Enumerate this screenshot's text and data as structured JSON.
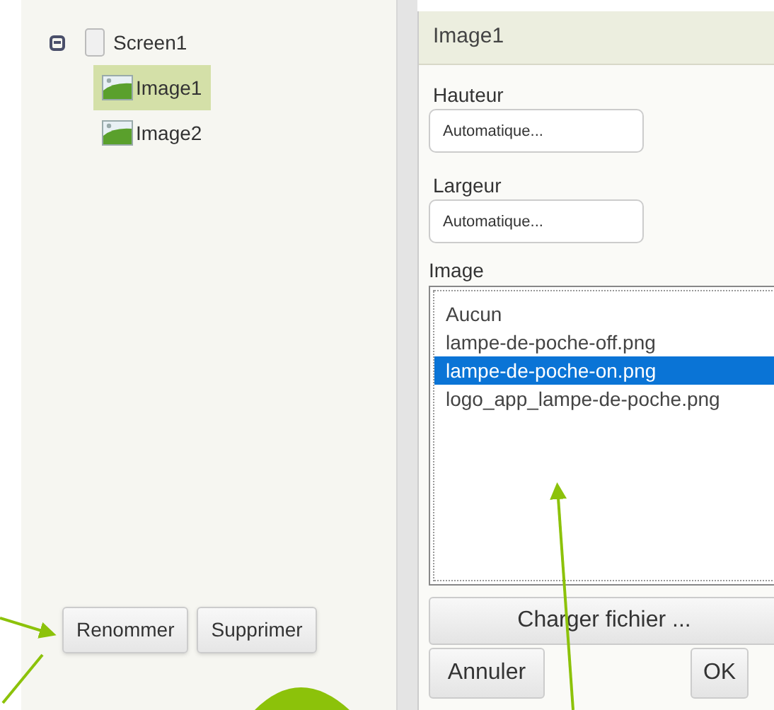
{
  "tree": {
    "label": "Screen1",
    "expanded": true,
    "children": [
      {
        "label": "Image1",
        "selected": true
      },
      {
        "label": "Image2",
        "selected": false
      }
    ]
  },
  "tree_buttons": [
    "Renommer",
    "Supprimer"
  ],
  "properties": {
    "title": "Image1",
    "fields": [
      {
        "label": "Hauteur",
        "value": "Automatique..."
      },
      {
        "label": "Largeur",
        "value": "Automatique..."
      }
    ],
    "image": {
      "label": "Image",
      "options": [
        {
          "label": "Aucun",
          "selected": false
        },
        {
          "label": "lampe-de-poche-off.png",
          "selected": false
        },
        {
          "label": "lampe-de-poche-on.png",
          "selected": true
        },
        {
          "label": "logo_app_lampe-de-poche.png",
          "selected": false
        }
      ],
      "upload_button": "Charger fichier ...",
      "cancel_button": "Annuler",
      "ok_button": "OK"
    }
  }
}
